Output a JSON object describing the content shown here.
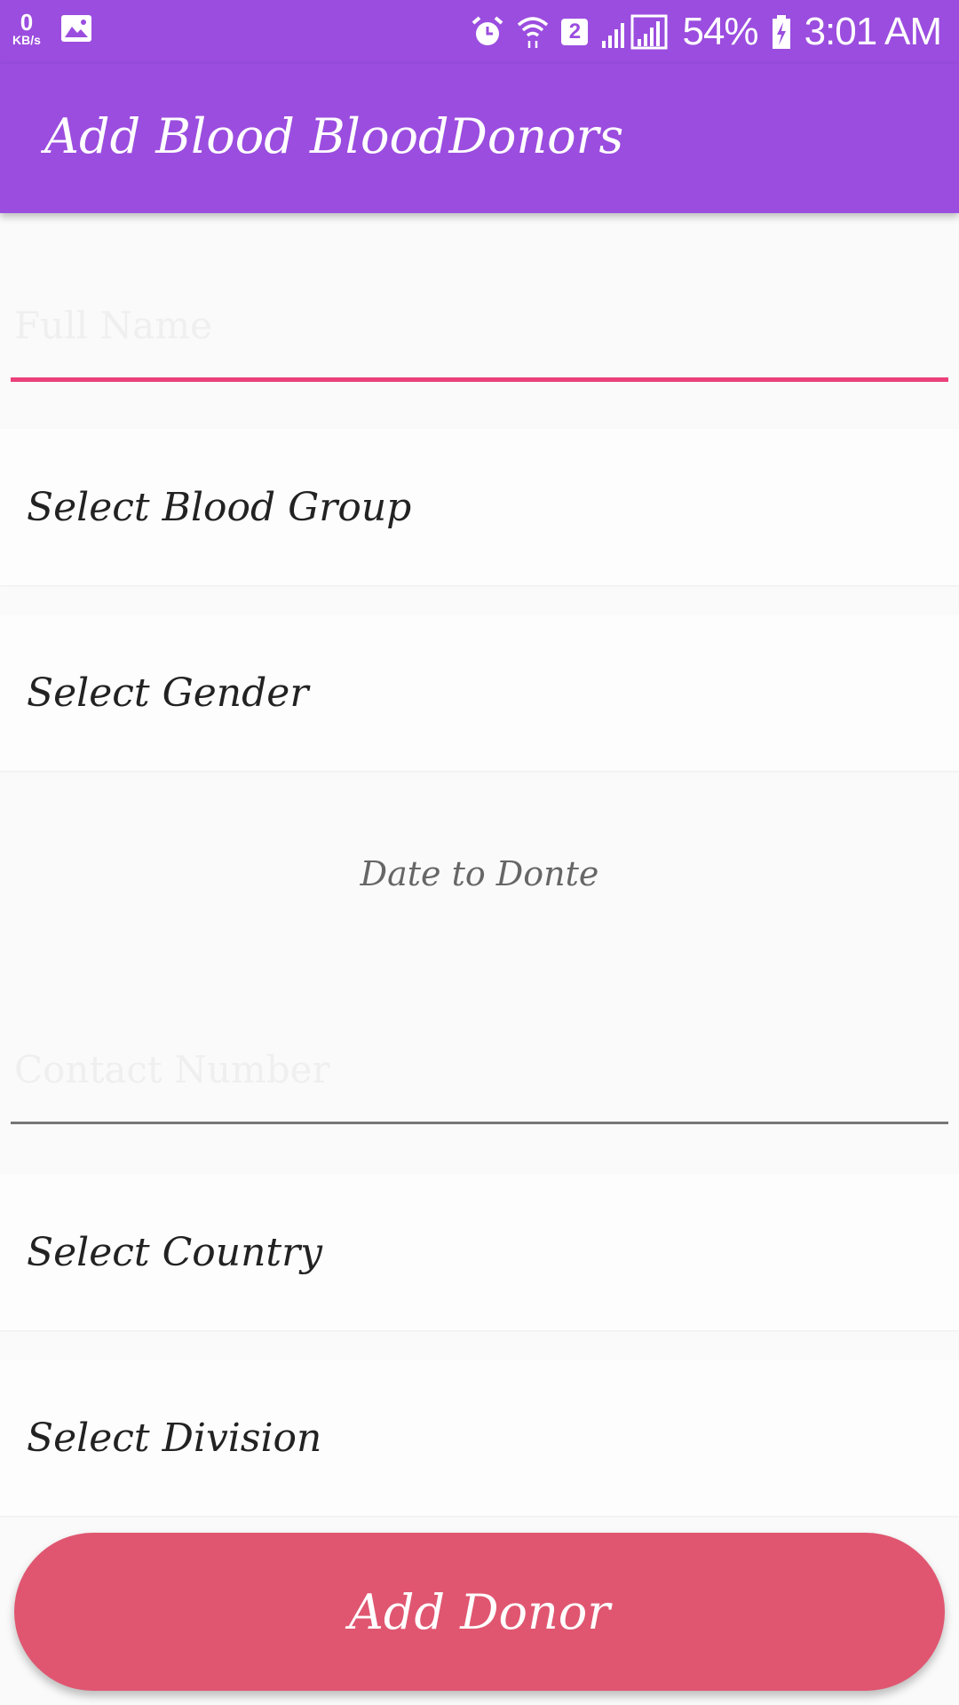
{
  "status_bar": {
    "net_speed_value": "0",
    "net_speed_unit": "KB/s",
    "sim_number": "2",
    "battery": "54%",
    "time": "3:01 AM",
    "icons": [
      "gallery-icon",
      "alarm-icon",
      "wifi-icon",
      "sim-icon",
      "signal-icon",
      "battery-icon"
    ]
  },
  "app_bar": {
    "title": "Add Blood BloodDonors",
    "color": "#9b4ddf"
  },
  "form": {
    "full_name_placeholder": "Full Name",
    "blood_group_label": "Select Blood Group",
    "gender_label": "Select Gender",
    "date_label": "Date to Donte",
    "contact_placeholder": "Contact Number",
    "country_label": "Select Country",
    "division_label": "Select Division",
    "accent_color": "#ec407a"
  },
  "actions": {
    "add_donor_label": "Add Donor",
    "button_color": "#e05670"
  }
}
